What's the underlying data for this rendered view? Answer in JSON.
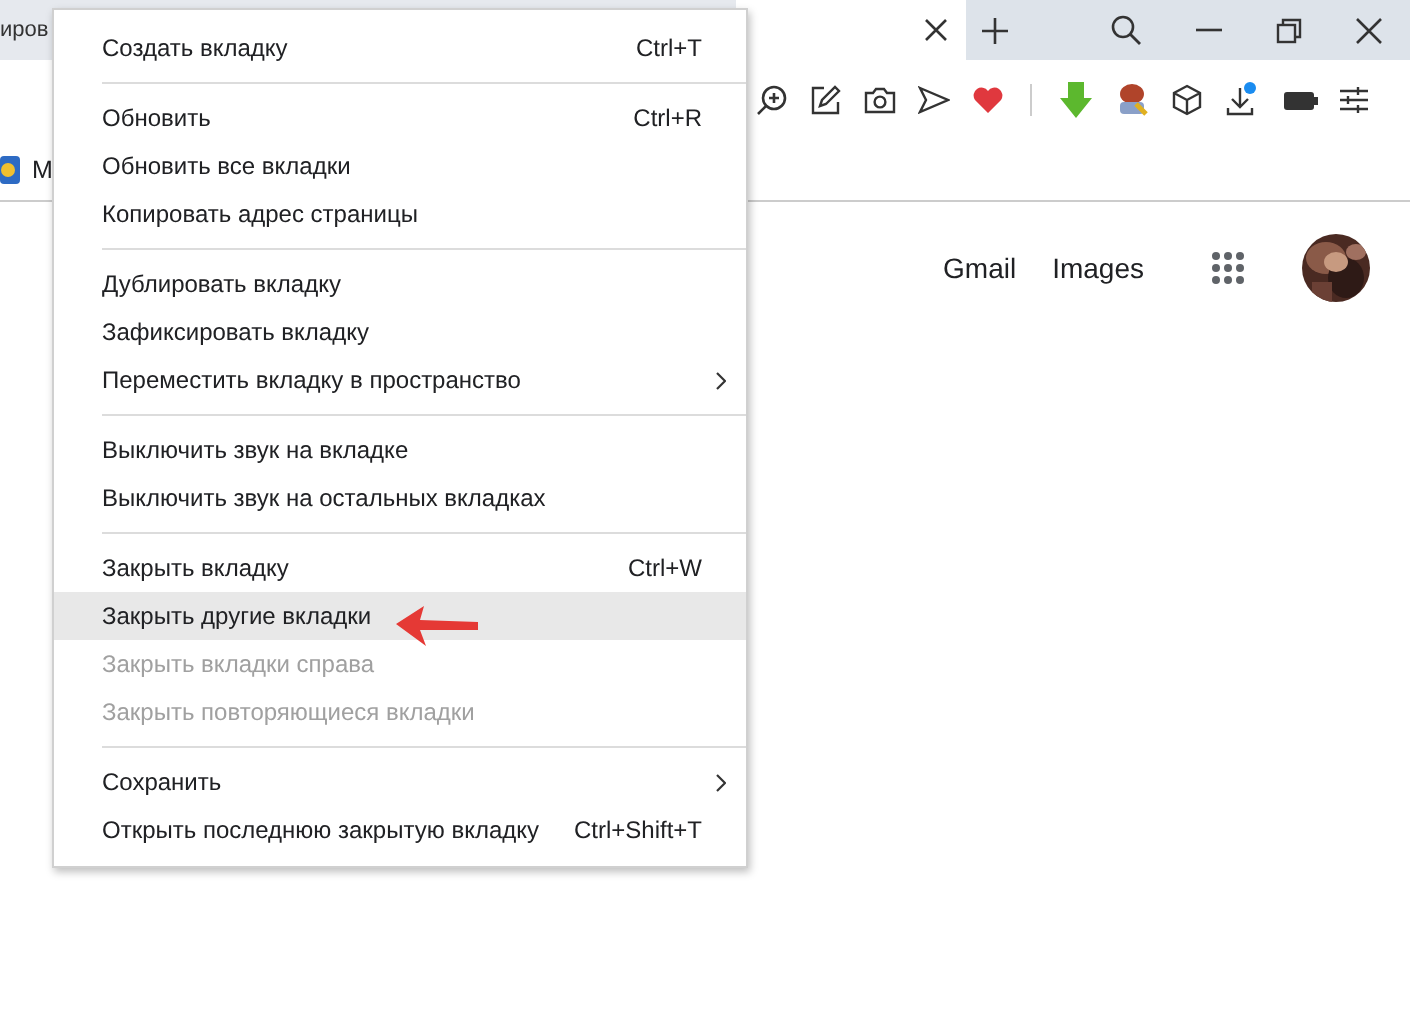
{
  "tabs": [
    {
      "label": "иров",
      "selected": false
    },
    {
      "selected": true
    }
  ],
  "bookmarks": [
    {
      "label": "M"
    }
  ],
  "header_links": [
    "Gmail",
    "Images"
  ],
  "context_menu": {
    "sections": [
      [
        {
          "label": "Создать вкладку",
          "shortcut": "Ctrl+T",
          "submenu": false,
          "disabled": false,
          "selected": false
        }
      ],
      [
        {
          "label": "Обновить",
          "shortcut": "Ctrl+R",
          "submenu": false,
          "disabled": false,
          "selected": false
        },
        {
          "label": "Обновить все вкладки",
          "submenu": false,
          "disabled": false,
          "selected": false
        },
        {
          "label": "Копировать адрес страницы",
          "submenu": false,
          "disabled": false,
          "selected": false
        }
      ],
      [
        {
          "label": "Дублировать вкладку",
          "submenu": false,
          "disabled": false,
          "selected": false
        },
        {
          "label": "Зафиксировать вкладку",
          "submenu": false,
          "disabled": false,
          "selected": false
        },
        {
          "label": "Переместить вкладку в пространство",
          "submenu": true,
          "disabled": false,
          "selected": false
        }
      ],
      [
        {
          "label": "Выключить звук на вкладке",
          "submenu": false,
          "disabled": false,
          "selected": false
        },
        {
          "label": "Выключить звук на остальных вкладках",
          "submenu": false,
          "disabled": false,
          "selected": false
        }
      ],
      [
        {
          "label": "Закрыть вкладку",
          "shortcut": "Ctrl+W",
          "submenu": false,
          "disabled": false,
          "selected": false
        },
        {
          "label": "Закрыть другие вкладки",
          "submenu": false,
          "disabled": false,
          "selected": true
        },
        {
          "label": "Закрыть вкладки справа",
          "submenu": false,
          "disabled": true,
          "selected": false
        },
        {
          "label": "Закрыть повторяющиеся вкладки",
          "submenu": false,
          "disabled": true,
          "selected": false
        }
      ],
      [
        {
          "label": "Сохранить",
          "submenu": true,
          "disabled": false,
          "selected": false
        },
        {
          "label": "Открыть последнюю закрытую вкладку",
          "shortcut": "Ctrl+Shift+T",
          "submenu": false,
          "disabled": false,
          "selected": false
        }
      ]
    ]
  }
}
